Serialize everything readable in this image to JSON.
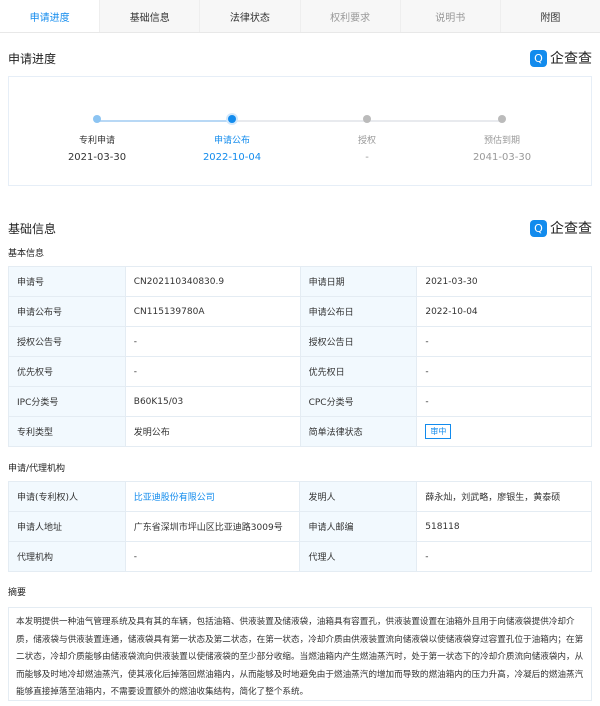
{
  "tabs": [
    "申请进度",
    "基础信息",
    "法律状态",
    "权利要求",
    "说明书",
    "附图"
  ],
  "progress": {
    "title": "申请进度",
    "logo": "企查查",
    "steps": [
      {
        "label": "专利申请",
        "date": "2021-03-30"
      },
      {
        "label": "申请公布",
        "date": "2022-10-04"
      },
      {
        "label": "授权",
        "date": "-"
      },
      {
        "label": "预估到期",
        "date": "2041-03-30"
      }
    ]
  },
  "basic": {
    "title": "基础信息",
    "logo": "企查查",
    "subtitle": "基本信息",
    "rows": [
      [
        "申请号",
        "CN202110340830.9",
        "申请日期",
        "2021-03-30"
      ],
      [
        "申请公布号",
        "CN115139780A",
        "申请公布日",
        "2022-10-04"
      ],
      [
        "授权公告号",
        "-",
        "授权公告日",
        "-"
      ],
      [
        "优先权号",
        "-",
        "优先权日",
        "-"
      ],
      [
        "IPC分类号",
        "B60K15/03",
        "CPC分类号",
        "-"
      ],
      [
        "专利类型",
        "发明公布",
        "简单法律状态",
        "审中"
      ]
    ]
  },
  "agency": {
    "subtitle": "申请/代理机构",
    "rows": [
      [
        "申请(专利权)人",
        "比亚迪股份有限公司",
        "发明人",
        "薛永灿，刘武略，廖银生，黄泰硕"
      ],
      [
        "申请人地址",
        "广东省深圳市坪山区比亚迪路3009号",
        "申请人邮编",
        "518118"
      ],
      [
        "代理机构",
        "-",
        "代理人",
        "-"
      ]
    ]
  },
  "abstract": {
    "title": "摘要",
    "text": "本发明提供一种油气管理系统及具有其的车辆，包括油箱、供液装置及储液袋，油箱具有容置孔，供液装置设置在油箱外且用于向储液袋提供冷却介质，储液袋与供液装置连通，储液袋具有第一状态及第二状态，在第一状态，冷却介质由供液装置流向储液袋以使储液袋穿过容置孔位于油箱内；在第二状态，冷却介质能够由储液袋流向供液装置以使储液袋的至少部分收缩。当燃油箱内产生燃油蒸汽时，处于第一状态下的冷却介质流向储液袋内，从而能够及时地冷却燃油蒸汽，使其液化后掉落回燃油箱内，从而能够及时地避免由于燃油蒸汽的增加而导致的燃油箱内的压力升高，冷凝后的燃油蒸汽能够直接掉落至油箱内，不需要设置额外的燃油收集结构，简化了整个系统。"
  }
}
